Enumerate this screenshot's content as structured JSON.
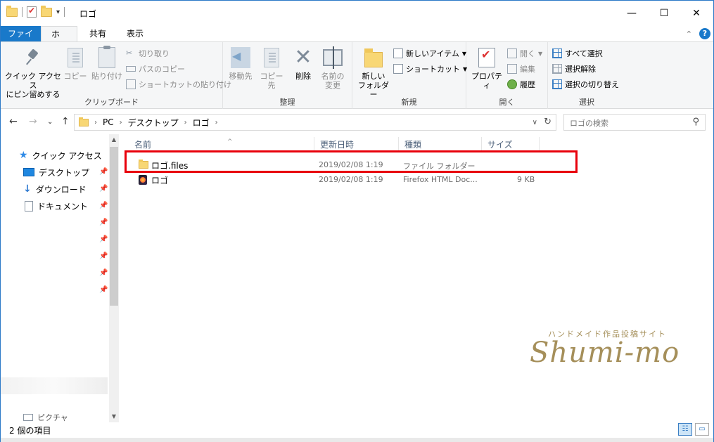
{
  "window": {
    "title": "ロゴ",
    "controls": {
      "minimize": "—",
      "maximize": "☐",
      "close": "✕"
    }
  },
  "ribbon": {
    "tabs": [
      "ファイル",
      "ホーム",
      "共有",
      "表示"
    ],
    "active_tab": "ホーム",
    "groups": {
      "clipboard": {
        "label": "クリップボード",
        "pin_quick_access": "クイック アクセス\nにピン留めする",
        "copy": "コピー",
        "paste": "貼り付け",
        "cut": "切り取り",
        "copy_path": "パスのコピー",
        "paste_shortcut": "ショートカットの貼り付け"
      },
      "organize": {
        "label": "整理",
        "move_to": "移動先",
        "copy_to": "コピー先",
        "delete": "削除",
        "rename": "名前の\n変更"
      },
      "new": {
        "label": "新規",
        "new_folder": "新しい\nフォルダー",
        "new_item": "新しいアイテム",
        "shortcut": "ショートカット"
      },
      "open": {
        "label": "開く",
        "properties": "プロパティ",
        "open": "開く",
        "edit": "編集",
        "history": "履歴"
      },
      "select": {
        "label": "選択",
        "select_all": "すべて選択",
        "select_none": "選択解除",
        "invert": "選択の切り替え"
      }
    }
  },
  "address": {
    "crumbs": [
      "PC",
      "デスクトップ",
      "ロゴ"
    ],
    "search_placeholder": "ロゴの検索"
  },
  "nav_pane": {
    "items": [
      {
        "label": "クイック アクセス",
        "icon": "star-icon"
      },
      {
        "label": "デスクトップ",
        "icon": "desktop-icon"
      },
      {
        "label": "ダウンロード",
        "icon": "download-icon"
      },
      {
        "label": "ドキュメント",
        "icon": "document-icon"
      }
    ],
    "partial_item": "ピクチャ"
  },
  "file_list": {
    "columns": [
      "名前",
      "更新日時",
      "種類",
      "サイズ"
    ],
    "rows": [
      {
        "name": "ロゴ.files",
        "modified": "2019/02/08 1:19",
        "type": "ファイル フォルダー",
        "size": "",
        "icon": "folder-icon"
      },
      {
        "name": "ロゴ",
        "modified": "2019/02/08 1:19",
        "type": "Firefox HTML Doc...",
        "size": "9 KB",
        "icon": "firefox-document-icon"
      }
    ]
  },
  "status_bar": {
    "item_count": "2 個の項目"
  },
  "watermark": {
    "subtitle": "ハンドメイド作品投稿サイト",
    "brand": "Shumi-mo"
  },
  "colors": {
    "accent": "#1979ca",
    "highlight_box": "#e8000b",
    "watermark": "#a58f5a"
  }
}
